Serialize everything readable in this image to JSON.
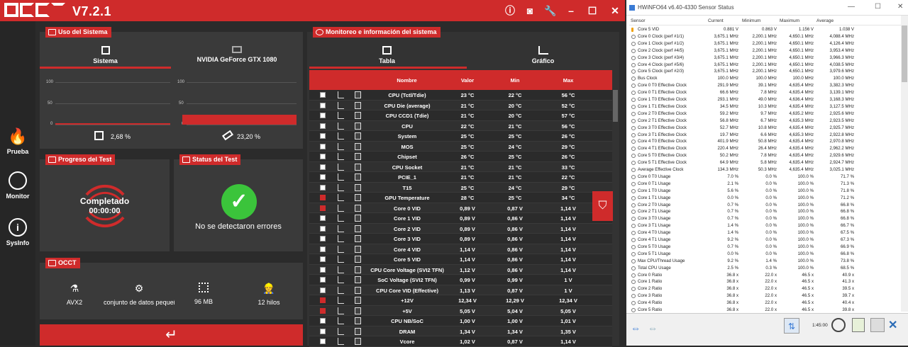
{
  "occt": {
    "version": "V7.2.1",
    "titlebar_icons": [
      "info-icon",
      "camera-icon",
      "wrench-icon",
      "minimize-icon",
      "maximize-icon",
      "close-icon"
    ],
    "nav": [
      {
        "label": "Prueba",
        "icon": "flame-icon"
      },
      {
        "label": "Monitor",
        "icon": "gauge-icon"
      },
      {
        "label": "SysInfo",
        "icon": "info-icon"
      }
    ],
    "system_usage": {
      "title": "Uso del Sistema",
      "tabs": [
        "Sistema",
        "NVIDIA GeForce GTX 1080"
      ],
      "axis": [
        "100",
        "50",
        "0"
      ],
      "cpu_percent": "2,68 %",
      "gpu_percent": "23,20 %",
      "cpu_level": 0.0268,
      "gpu_level": 0.232
    },
    "progress": {
      "title": "Progreso del Test",
      "status": "Completado",
      "time": "00:00:00"
    },
    "test_status": {
      "title": "Status del Test",
      "message": "No se detectaron errores",
      "accent": "#3bc43b"
    },
    "config": {
      "title": "OCCT",
      "items": [
        {
          "label": "AVX2",
          "icon": "flask-icon"
        },
        {
          "label": "conjunto de datos pequeñ",
          "icon": "gears-icon"
        },
        {
          "label": "96 MB",
          "icon": "chip-icon"
        },
        {
          "label": "12 hilos",
          "icon": "worker-icon"
        }
      ]
    },
    "monitor": {
      "title": "Monitoreo e información del sistema",
      "tabs": [
        "Tabla",
        "Gráfico"
      ],
      "columns": [
        "Nombre",
        "Valor",
        "Min",
        "Max"
      ],
      "rows": [
        {
          "name": "CPU (Tctl/Tdie)",
          "val": "23 °C",
          "min": "22 °C",
          "max": "56 °C",
          "on": false
        },
        {
          "name": "CPU Die (average)",
          "val": "21 °C",
          "min": "20 °C",
          "max": "52 °C",
          "on": false
        },
        {
          "name": "CPU CCD1 (Tdie)",
          "val": "21 °C",
          "min": "20 °C",
          "max": "57 °C",
          "on": false
        },
        {
          "name": "CPU",
          "val": "22 °C",
          "min": "21 °C",
          "max": "56 °C",
          "on": false
        },
        {
          "name": "System",
          "val": "25 °C",
          "min": "25 °C",
          "max": "26 °C",
          "on": false
        },
        {
          "name": "MOS",
          "val": "25 °C",
          "min": "24 °C",
          "max": "29 °C",
          "on": false
        },
        {
          "name": "Chipset",
          "val": "26 °C",
          "min": "25 °C",
          "max": "26 °C",
          "on": false
        },
        {
          "name": "CPU Socket",
          "val": "21 °C",
          "min": "21 °C",
          "max": "33 °C",
          "on": false
        },
        {
          "name": "PCIE_1",
          "val": "21 °C",
          "min": "21 °C",
          "max": "22 °C",
          "on": false
        },
        {
          "name": "T15",
          "val": "25 °C",
          "min": "24 °C",
          "max": "29 °C",
          "on": false
        },
        {
          "name": "GPU Temperature",
          "val": "28 °C",
          "min": "25 °C",
          "max": "34 °C",
          "on": true
        },
        {
          "name": "Core 0 VID",
          "val": "0,89 V",
          "min": "0,87 V",
          "max": "1,14 V",
          "on": true
        },
        {
          "name": "Core 1 VID",
          "val": "0,89 V",
          "min": "0,86 V",
          "max": "1,14 V",
          "on": false
        },
        {
          "name": "Core 2 VID",
          "val": "0,89 V",
          "min": "0,86 V",
          "max": "1,14 V",
          "on": false
        },
        {
          "name": "Core 3 VID",
          "val": "0,89 V",
          "min": "0,86 V",
          "max": "1,14 V",
          "on": false
        },
        {
          "name": "Core 4 VID",
          "val": "1,14 V",
          "min": "0,86 V",
          "max": "1,14 V",
          "on": false
        },
        {
          "name": "Core 5 VID",
          "val": "1,14 V",
          "min": "0,86 V",
          "max": "1,14 V",
          "on": false
        },
        {
          "name": "CPU Core Voltage (SVI2 TFN)",
          "val": "1,12 V",
          "min": "0,86 V",
          "max": "1,14 V",
          "on": false
        },
        {
          "name": "SoC Voltage (SVI2 TFN)",
          "val": "0,99 V",
          "min": "0,99 V",
          "max": "1 V",
          "on": false
        },
        {
          "name": "CPU Core VID (Effective)",
          "val": "1,13 V",
          "min": "0,87 V",
          "max": "1 V",
          "on": false
        },
        {
          "name": "+12V",
          "val": "12,34 V",
          "min": "12,29 V",
          "max": "12,34 V",
          "on": true
        },
        {
          "name": "+5V",
          "val": "5,05 V",
          "min": "5,04 V",
          "max": "5,05 V",
          "on": true
        },
        {
          "name": "CPU NB/SoC",
          "val": "1,00 V",
          "min": "1,00 V",
          "max": "1,01 V",
          "on": false
        },
        {
          "name": "DRAM",
          "val": "1,34 V",
          "min": "1,34 V",
          "max": "1,35 V",
          "on": false
        },
        {
          "name": "Vcore",
          "val": "1,02 V",
          "min": "0,87 V",
          "max": "1,14 V",
          "on": false
        }
      ]
    }
  },
  "hwinfo": {
    "title": "HWiNFO64 v6.40-4330 Sensor Status",
    "columns": [
      "Sensor",
      "Current",
      "Minimum",
      "Maximum",
      "Average"
    ],
    "rows": [
      [
        "Core 5 VID",
        "0.881 V",
        "0.863 V",
        "1.156 V",
        "1.038 V"
      ],
      [
        "Core 0 Clock (perf #1/1)",
        "3,675.1 MHz",
        "2,200.1 MHz",
        "4,650.1 MHz",
        "4,088.4 MHz"
      ],
      [
        "Core 1 Clock (perf #1/2)",
        "3,675.1 MHz",
        "2,200.1 MHz",
        "4,650.1 MHz",
        "4,126.4 MHz"
      ],
      [
        "Core 2 Clock (perf #4/5)",
        "3,675.1 MHz",
        "2,200.1 MHz",
        "4,650.1 MHz",
        "3,953.4 MHz"
      ],
      [
        "Core 3 Clock (perf #3/4)",
        "3,675.1 MHz",
        "2,200.1 MHz",
        "4,650.1 MHz",
        "3,966.3 MHz"
      ],
      [
        "Core 4 Clock (perf #5/6)",
        "3,675.1 MHz",
        "2,200.1 MHz",
        "4,650.1 MHz",
        "4,038.5 MHz"
      ],
      [
        "Core 5 Clock (perf #2/3)",
        "3,675.1 MHz",
        "2,200.1 MHz",
        "4,650.1 MHz",
        "3,979.6 MHz"
      ],
      [
        "Bus Clock",
        "100.0 MHz",
        "100.0 MHz",
        "100.0 MHz",
        "100.0 MHz"
      ],
      [
        "Core 0 T0 Effective Clock",
        "291.9 MHz",
        "39.1 MHz",
        "4,635.4 MHz",
        "3,382.3 MHz"
      ],
      [
        "Core 0 T1 Effective Clock",
        "66.6 MHz",
        "7.8 MHz",
        "4,635.4 MHz",
        "3,139.1 MHz"
      ],
      [
        "Core 1 T0 Effective Clock",
        "293.1 MHz",
        "49.0 MHz",
        "4,636.4 MHz",
        "3,168.3 MHz"
      ],
      [
        "Core 1 T1 Effective Clock",
        "34.5 MHz",
        "10.3 MHz",
        "4,635.4 MHz",
        "3,127.5 MHz"
      ],
      [
        "Core 2 T0 Effective Clock",
        "59.2 MHz",
        "9.7 MHz",
        "4,635.2 MHz",
        "2,925.6 MHz"
      ],
      [
        "Core 2 T1 Effective Clock",
        "56.8 MHz",
        "6.7 MHz",
        "4,635.3 MHz",
        "2,923.5 MHz"
      ],
      [
        "Core 3 T0 Effective Clock",
        "52.7 MHz",
        "10.8 MHz",
        "4,635.4 MHz",
        "2,925.7 MHz"
      ],
      [
        "Core 3 T1 Effective Clock",
        "19.7 MHz",
        "6.6 MHz",
        "4,635.3 MHz",
        "2,922.8 MHz"
      ],
      [
        "Core 4 T0 Effective Clock",
        "401.9 MHz",
        "50.8 MHz",
        "4,635.4 MHz",
        "2,970.8 MHz"
      ],
      [
        "Core 4 T1 Effective Clock",
        "220.4 MHz",
        "26.4 MHz",
        "4,635.4 MHz",
        "2,962.2 MHz"
      ],
      [
        "Core 5 T0 Effective Clock",
        "50.2 MHz",
        "7.8 MHz",
        "4,635.4 MHz",
        "2,929.6 MHz"
      ],
      [
        "Core 5 T1 Effective Clock",
        "64.9 MHz",
        "5.8 MHz",
        "4,635.4 MHz",
        "2,924.7 MHz"
      ],
      [
        "Average Effective Clock",
        "134.3 MHz",
        "50.3 MHz",
        "4,635.4 MHz",
        "3,025.1 MHz"
      ],
      [
        "Core 0 T0 Usage",
        "7.0 %",
        "0.0 %",
        "100.0 %",
        "71.7 %"
      ],
      [
        "Core 0 T1 Usage",
        "2.1 %",
        "0.0 %",
        "100.0 %",
        "71.3 %"
      ],
      [
        "Core 1 T0 Usage",
        "5.6 %",
        "0.0 %",
        "100.0 %",
        "71.8 %"
      ],
      [
        "Core 1 T1 Usage",
        "0.0 %",
        "0.0 %",
        "100.0 %",
        "71.2 %"
      ],
      [
        "Core 2 T0 Usage",
        "0.7 %",
        "0.0 %",
        "100.0 %",
        "66.8 %"
      ],
      [
        "Core 2 T1 Usage",
        "0.7 %",
        "0.0 %",
        "100.0 %",
        "66.8 %"
      ],
      [
        "Core 3 T0 Usage",
        "0.7 %",
        "0.0 %",
        "100.0 %",
        "66.8 %"
      ],
      [
        "Core 3 T1 Usage",
        "1.4 %",
        "0.0 %",
        "100.0 %",
        "66.7 %"
      ],
      [
        "Core 4 T0 Usage",
        "1.4 %",
        "0.0 %",
        "100.0 %",
        "67.5 %"
      ],
      [
        "Core 4 T1 Usage",
        "9.2 %",
        "0.0 %",
        "100.0 %",
        "67.3 %"
      ],
      [
        "Core 5 T0 Usage",
        "0.7 %",
        "0.0 %",
        "100.0 %",
        "66.9 %"
      ],
      [
        "Core 5 T1 Usage",
        "0.0 %",
        "0.0 %",
        "100.0 %",
        "66.8 %"
      ],
      [
        "Max CPU/Thread Usage",
        "9.2 %",
        "1.4 %",
        "100.0 %",
        "73.8 %"
      ],
      [
        "Total CPU Usage",
        "2.5 %",
        "0.3 %",
        "100.0 %",
        "68.5 %"
      ],
      [
        "Core 0 Ratio",
        "36.8 x",
        "22.0 x",
        "46.5 x",
        "40.9 x"
      ],
      [
        "Core 1 Ratio",
        "36.8 x",
        "22.0 x",
        "46.5 x",
        "41.3 x"
      ],
      [
        "Core 2 Ratio",
        "36.8 x",
        "22.0 x",
        "46.5 x",
        "39.5 x"
      ],
      [
        "Core 3 Ratio",
        "36.8 x",
        "22.0 x",
        "46.5 x",
        "39.7 x"
      ],
      [
        "Core 4 Ratio",
        "36.8 x",
        "22.0 x",
        "46.5 x",
        "40.4 x"
      ],
      [
        "Core 5 Ratio",
        "36.8 x",
        "22.0 x",
        "46.5 x",
        "39.8 x"
      ]
    ],
    "timer": "1:45:00"
  }
}
